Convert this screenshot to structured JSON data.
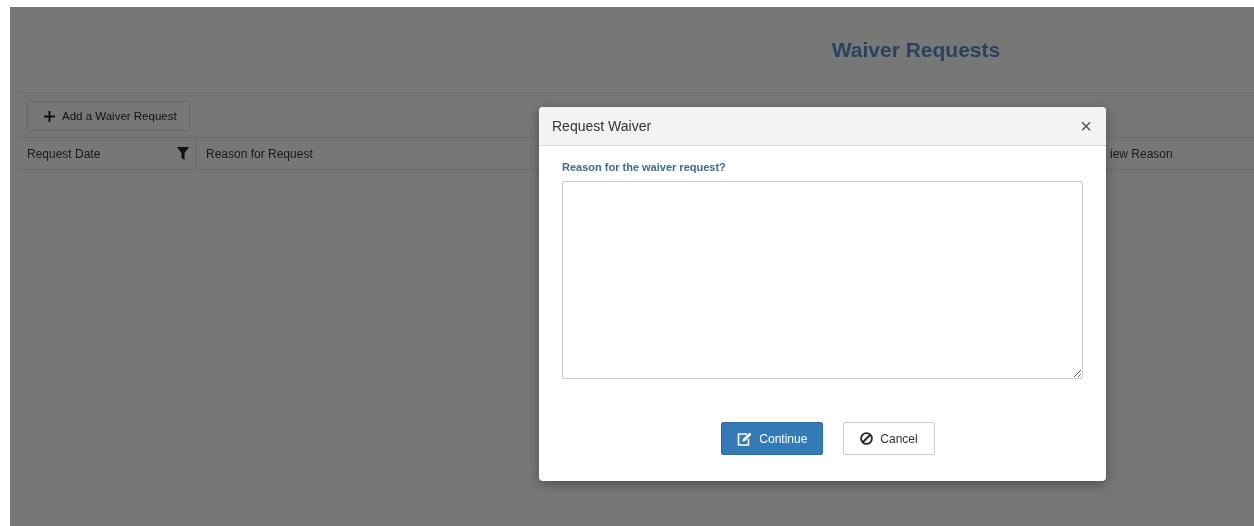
{
  "page": {
    "title": "Waiver Requests"
  },
  "toolbar": {
    "add_button": "Add a Waiver Request"
  },
  "table": {
    "columns": [
      {
        "label": "Request Date",
        "filter": true
      },
      {
        "label": "Reason for Request"
      },
      {
        "label": "iew Reason"
      }
    ]
  },
  "dialog": {
    "title": "Request Waiver",
    "close": "×",
    "field": {
      "label": "Reason for the waiver request?"
    },
    "buttons": [
      {
        "label": "Continue",
        "kind": "primary"
      },
      {
        "label": "Cancel",
        "kind": "cancel"
      }
    ]
  }
}
